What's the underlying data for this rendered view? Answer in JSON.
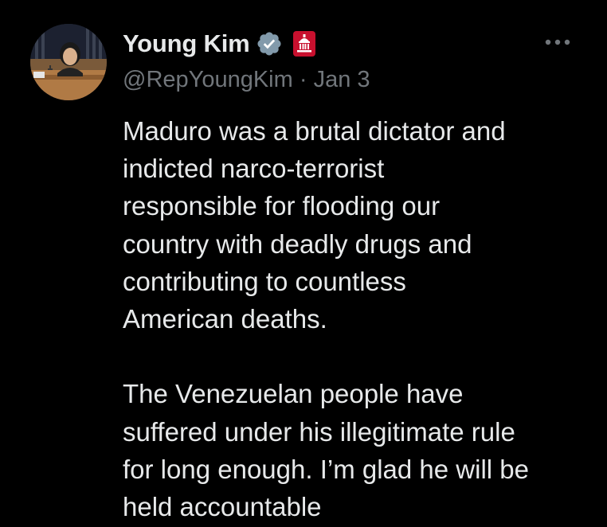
{
  "author": {
    "display_name": "Young Kim",
    "handle": "@RepYoungKim",
    "separator": "·",
    "date": "Jan 3"
  },
  "icons": {
    "verified": "verified-badge-icon",
    "affiliation": "government-affiliation-icon",
    "more": "more-options-icon"
  },
  "colors": {
    "background": "#000000",
    "primary_text": "#e7e9ea",
    "secondary_text": "#71767b",
    "verified_badge": "#829aab",
    "gov_badge": "#c8102e"
  },
  "tweet": {
    "paragraph_1": "Maduro was a brutal dictator and\nindicted narco-terrorist\nresponsible for flooding our\ncountry with deadly drugs and\ncontributing to countless\nAmerican deaths.",
    "paragraph_2": "The Venezuelan people have\nsuffered under his illegitimate rule\nfor long enough. I’m glad he will be\nheld accountable"
  }
}
